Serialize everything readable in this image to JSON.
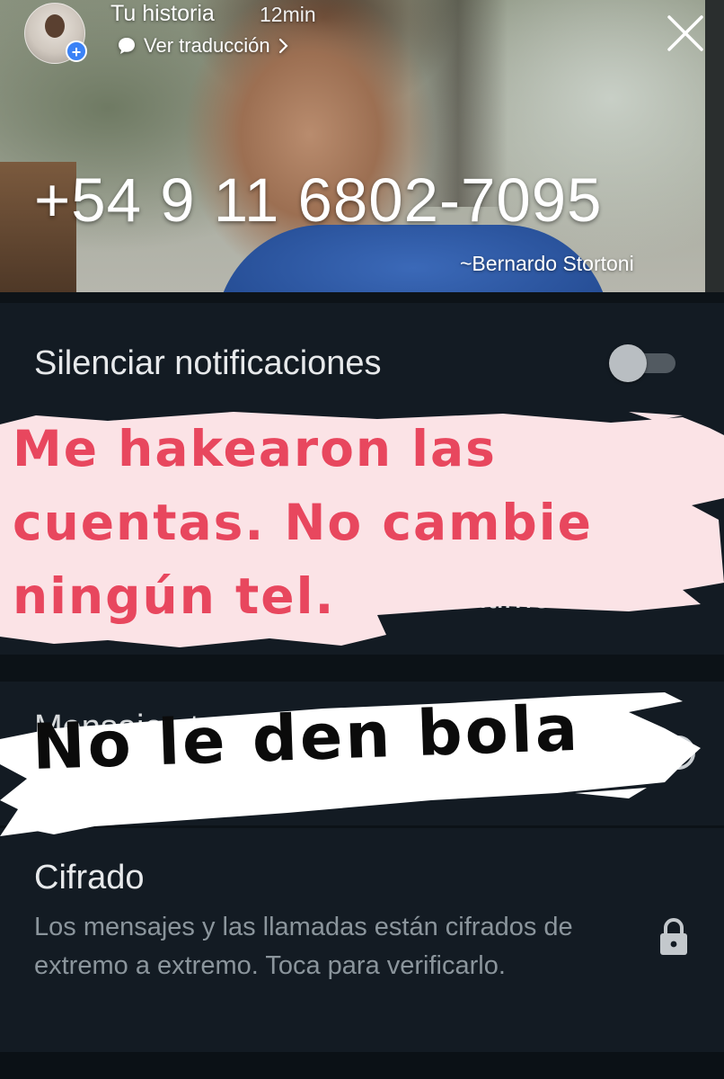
{
  "story": {
    "title": "Tu historia",
    "time": "12min",
    "translate_label": "Ver traducción",
    "phone_number": "+54 9 11 6802-7095",
    "byline": "~Bernardo Stortoni"
  },
  "settings": {
    "mute_label": "Silenciar notificaciones",
    "media_row_visible": "os multimedia",
    "messages_row_visible": "Mensajes te",
    "encryption_title": "Cifrado",
    "encryption_desc": "Los mensajes y las llamadas están cifrados de extremo a extremo. Toca para verificarlo."
  },
  "overlay": {
    "pink_text": "Me hakearon las\ncuentas. No cambie\nningún tel.",
    "black_text": "No le den bola"
  },
  "icons": {
    "close": "close-icon",
    "translate": "speech-bubble-icon",
    "chevron": "chevron-right-icon",
    "add": "plus-icon",
    "timer": "timer-icon",
    "lock": "lock-icon"
  },
  "colors": {
    "panel_bg": "#131b23",
    "pink_text": "#e8475e",
    "pink_brush": "#fbe3e6",
    "toggle_track": "#525a61"
  }
}
